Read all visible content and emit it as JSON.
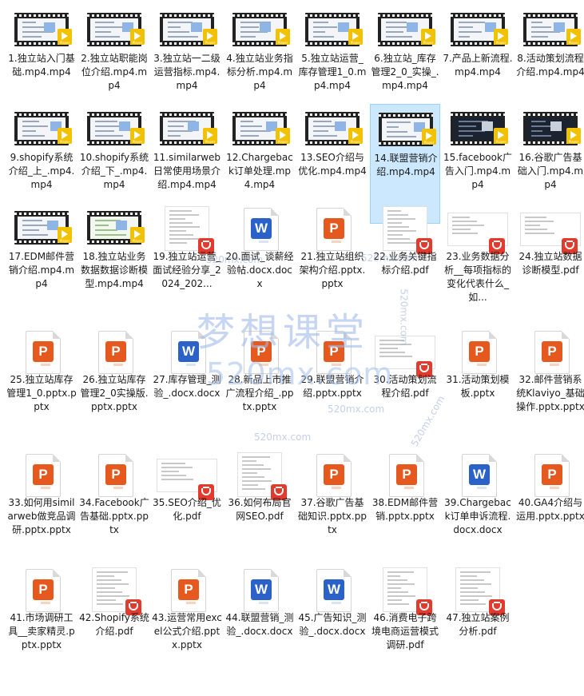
{
  "files": [
    {
      "name": "1.独立站入门基础.mp4.mp4",
      "type": "video",
      "thumb": "light",
      "selected": false
    },
    {
      "name": "2.独立站职能岗位介绍.mp4.mp4",
      "type": "video",
      "thumb": "light",
      "selected": false
    },
    {
      "name": "3.独立站一二级运营指标.mp4.mp4",
      "type": "video",
      "thumb": "light",
      "selected": false
    },
    {
      "name": "4.独立站业务指标分析.mp4.mp4",
      "type": "video",
      "thumb": "light",
      "selected": false
    },
    {
      "name": "5.独立站运营_库存管理1_0.mp4.mp4",
      "type": "video",
      "thumb": "light",
      "selected": false
    },
    {
      "name": "6.独立站_库存管理2_0_实操_.mp4.mp4",
      "type": "video",
      "thumb": "light",
      "selected": false
    },
    {
      "name": "7.产品上新流程.mp4.mp4",
      "type": "video",
      "thumb": "light",
      "selected": false
    },
    {
      "name": "8.活动策划流程介绍.mp4.mp4",
      "type": "video",
      "thumb": "light",
      "selected": false
    },
    {
      "name": "9.shopify系统介绍_上_.mp4.mp4",
      "type": "video",
      "thumb": "light",
      "selected": false
    },
    {
      "name": "10.shopify系统介绍_下_.mp4.mp4",
      "type": "video",
      "thumb": "light",
      "selected": false
    },
    {
      "name": "11.similarweb日常使用场景介绍.mp4.mp4",
      "type": "video",
      "thumb": "light",
      "selected": false
    },
    {
      "name": "12.Chargeback订单处理.mp4.mp4",
      "type": "video",
      "thumb": "light",
      "selected": false
    },
    {
      "name": "13.SEO介绍与优化.mp4.mp4",
      "type": "video",
      "thumb": "light",
      "selected": false
    },
    {
      "name": "14.联盟营销介绍.mp4.mp4",
      "type": "video",
      "thumb": "light",
      "selected": true
    },
    {
      "name": "15.facebook广告入门.mp4.mp4",
      "type": "video",
      "thumb": "dark",
      "selected": false
    },
    {
      "name": "16.谷歌广告基础入门.mp4.mp4",
      "type": "video",
      "thumb": "dark",
      "selected": false
    },
    {
      "name": "17.EDM邮件营销介绍.mp4.mp4",
      "type": "video",
      "thumb": "light",
      "selected": false
    },
    {
      "name": "18.独立站业务数据数据诊断模型.mp4.mp4",
      "type": "video",
      "thumb": "mind",
      "selected": false
    },
    {
      "name": "19.独立站运营_面试经验分享_2024_202...",
      "type": "pdf",
      "thumb": "doc",
      "selected": false
    },
    {
      "name": "20.面试_谈薪经验帖.docx.docx",
      "type": "word",
      "thumb": "",
      "selected": false
    },
    {
      "name": "21.独立站组织架构介绍.pptx.pptx",
      "type": "ppt",
      "thumb": "",
      "selected": false
    },
    {
      "name": "22.业务关键指标介绍.pdf",
      "type": "pdf",
      "thumb": "doc",
      "selected": false
    },
    {
      "name": "23.业务数据分析__每项指标的变化代表什么_如...",
      "type": "pdf",
      "thumb": "wide",
      "selected": false
    },
    {
      "name": "24.独立站数据诊断模型.pdf",
      "type": "pdf",
      "thumb": "wide",
      "selected": false
    },
    {
      "name": "25.独立站库存管理1_0.pptx.pptx",
      "type": "ppt",
      "thumb": "",
      "selected": false
    },
    {
      "name": "26.独立站库存管理2_0实操版.pptx.pptx",
      "type": "ppt",
      "thumb": "",
      "selected": false
    },
    {
      "name": "27.库存管理_测验_.docx.docx",
      "type": "word",
      "thumb": "",
      "selected": false
    },
    {
      "name": "28.新品上市推广流程介绍_.pptx.pptx",
      "type": "ppt",
      "thumb": "",
      "selected": false
    },
    {
      "name": "29.联盟营销介绍.pptx.pptx",
      "type": "ppt",
      "thumb": "",
      "selected": false
    },
    {
      "name": "30.活动策划流程介绍.pdf",
      "type": "pdf",
      "thumb": "wide",
      "selected": false
    },
    {
      "name": "31.活动策划模板.pptx",
      "type": "ppt",
      "thumb": "",
      "selected": false
    },
    {
      "name": "32.邮件营销系统Klaviyo_基础操作.pptx.pptx",
      "type": "ppt",
      "thumb": "",
      "selected": false
    },
    {
      "name": "33.如何用similarweb做竞品调研.pptx.pptx",
      "type": "ppt",
      "thumb": "",
      "selected": false
    },
    {
      "name": "34.Facebook广告基础.pptx.pptx",
      "type": "ppt",
      "thumb": "",
      "selected": false
    },
    {
      "name": "35.SEO介绍_优化.pdf",
      "type": "pdf",
      "thumb": "wide",
      "selected": false
    },
    {
      "name": "36.如何布局官网SEO.pdf",
      "type": "pdf",
      "thumb": "doc",
      "selected": false
    },
    {
      "name": "37.谷歌广告基础知识.pptx.pptx",
      "type": "ppt",
      "thumb": "",
      "selected": false
    },
    {
      "name": "38.EDM邮件营销.pptx.pptx",
      "type": "ppt",
      "thumb": "",
      "selected": false
    },
    {
      "name": "39.Chargeback订单申诉流程.docx.docx",
      "type": "word",
      "thumb": "",
      "selected": false
    },
    {
      "name": "40.GA4介绍与运用.pptx.pptx",
      "type": "ppt",
      "thumb": "",
      "selected": false
    },
    {
      "name": "41.市场调研工具__卖家精灵.pptx.pptx",
      "type": "ppt",
      "thumb": "",
      "selected": false
    },
    {
      "name": "42.Shopify系统介绍.pdf",
      "type": "pdf",
      "thumb": "doc",
      "selected": false
    },
    {
      "name": "43.运营常用excel公式介绍.pptx.pptx",
      "type": "ppt",
      "thumb": "",
      "selected": false
    },
    {
      "name": "44.联盟营销_测验_.docx.docx",
      "type": "word",
      "thumb": "",
      "selected": false
    },
    {
      "name": "45.广告知识_测验_.docx.docx",
      "type": "word",
      "thumb": "",
      "selected": false
    },
    {
      "name": "46.消费电子跨境电商运营模式调研.pdf",
      "type": "pdf",
      "thumb": "doc",
      "selected": false
    },
    {
      "name": "47.独立站案例分析.pdf",
      "type": "pdf",
      "thumb": "doc",
      "selected": false
    }
  ],
  "icons": {
    "video": "video-file-icon",
    "ppt": "powerpoint-file-icon",
    "word": "word-file-icon",
    "pdf": "pdf-file-icon"
  },
  "badges": {
    "ppt": "P",
    "word": "W",
    "player": "Player"
  },
  "watermark": {
    "title": "梦想课堂",
    "url": "520mx.com",
    "small": "520mx.com"
  },
  "colors": {
    "selection": "#cce8ff",
    "ppt": "#e5591f",
    "word": "#2b62c9",
    "pdf": "#e23b2e",
    "player": "#f2c100"
  }
}
